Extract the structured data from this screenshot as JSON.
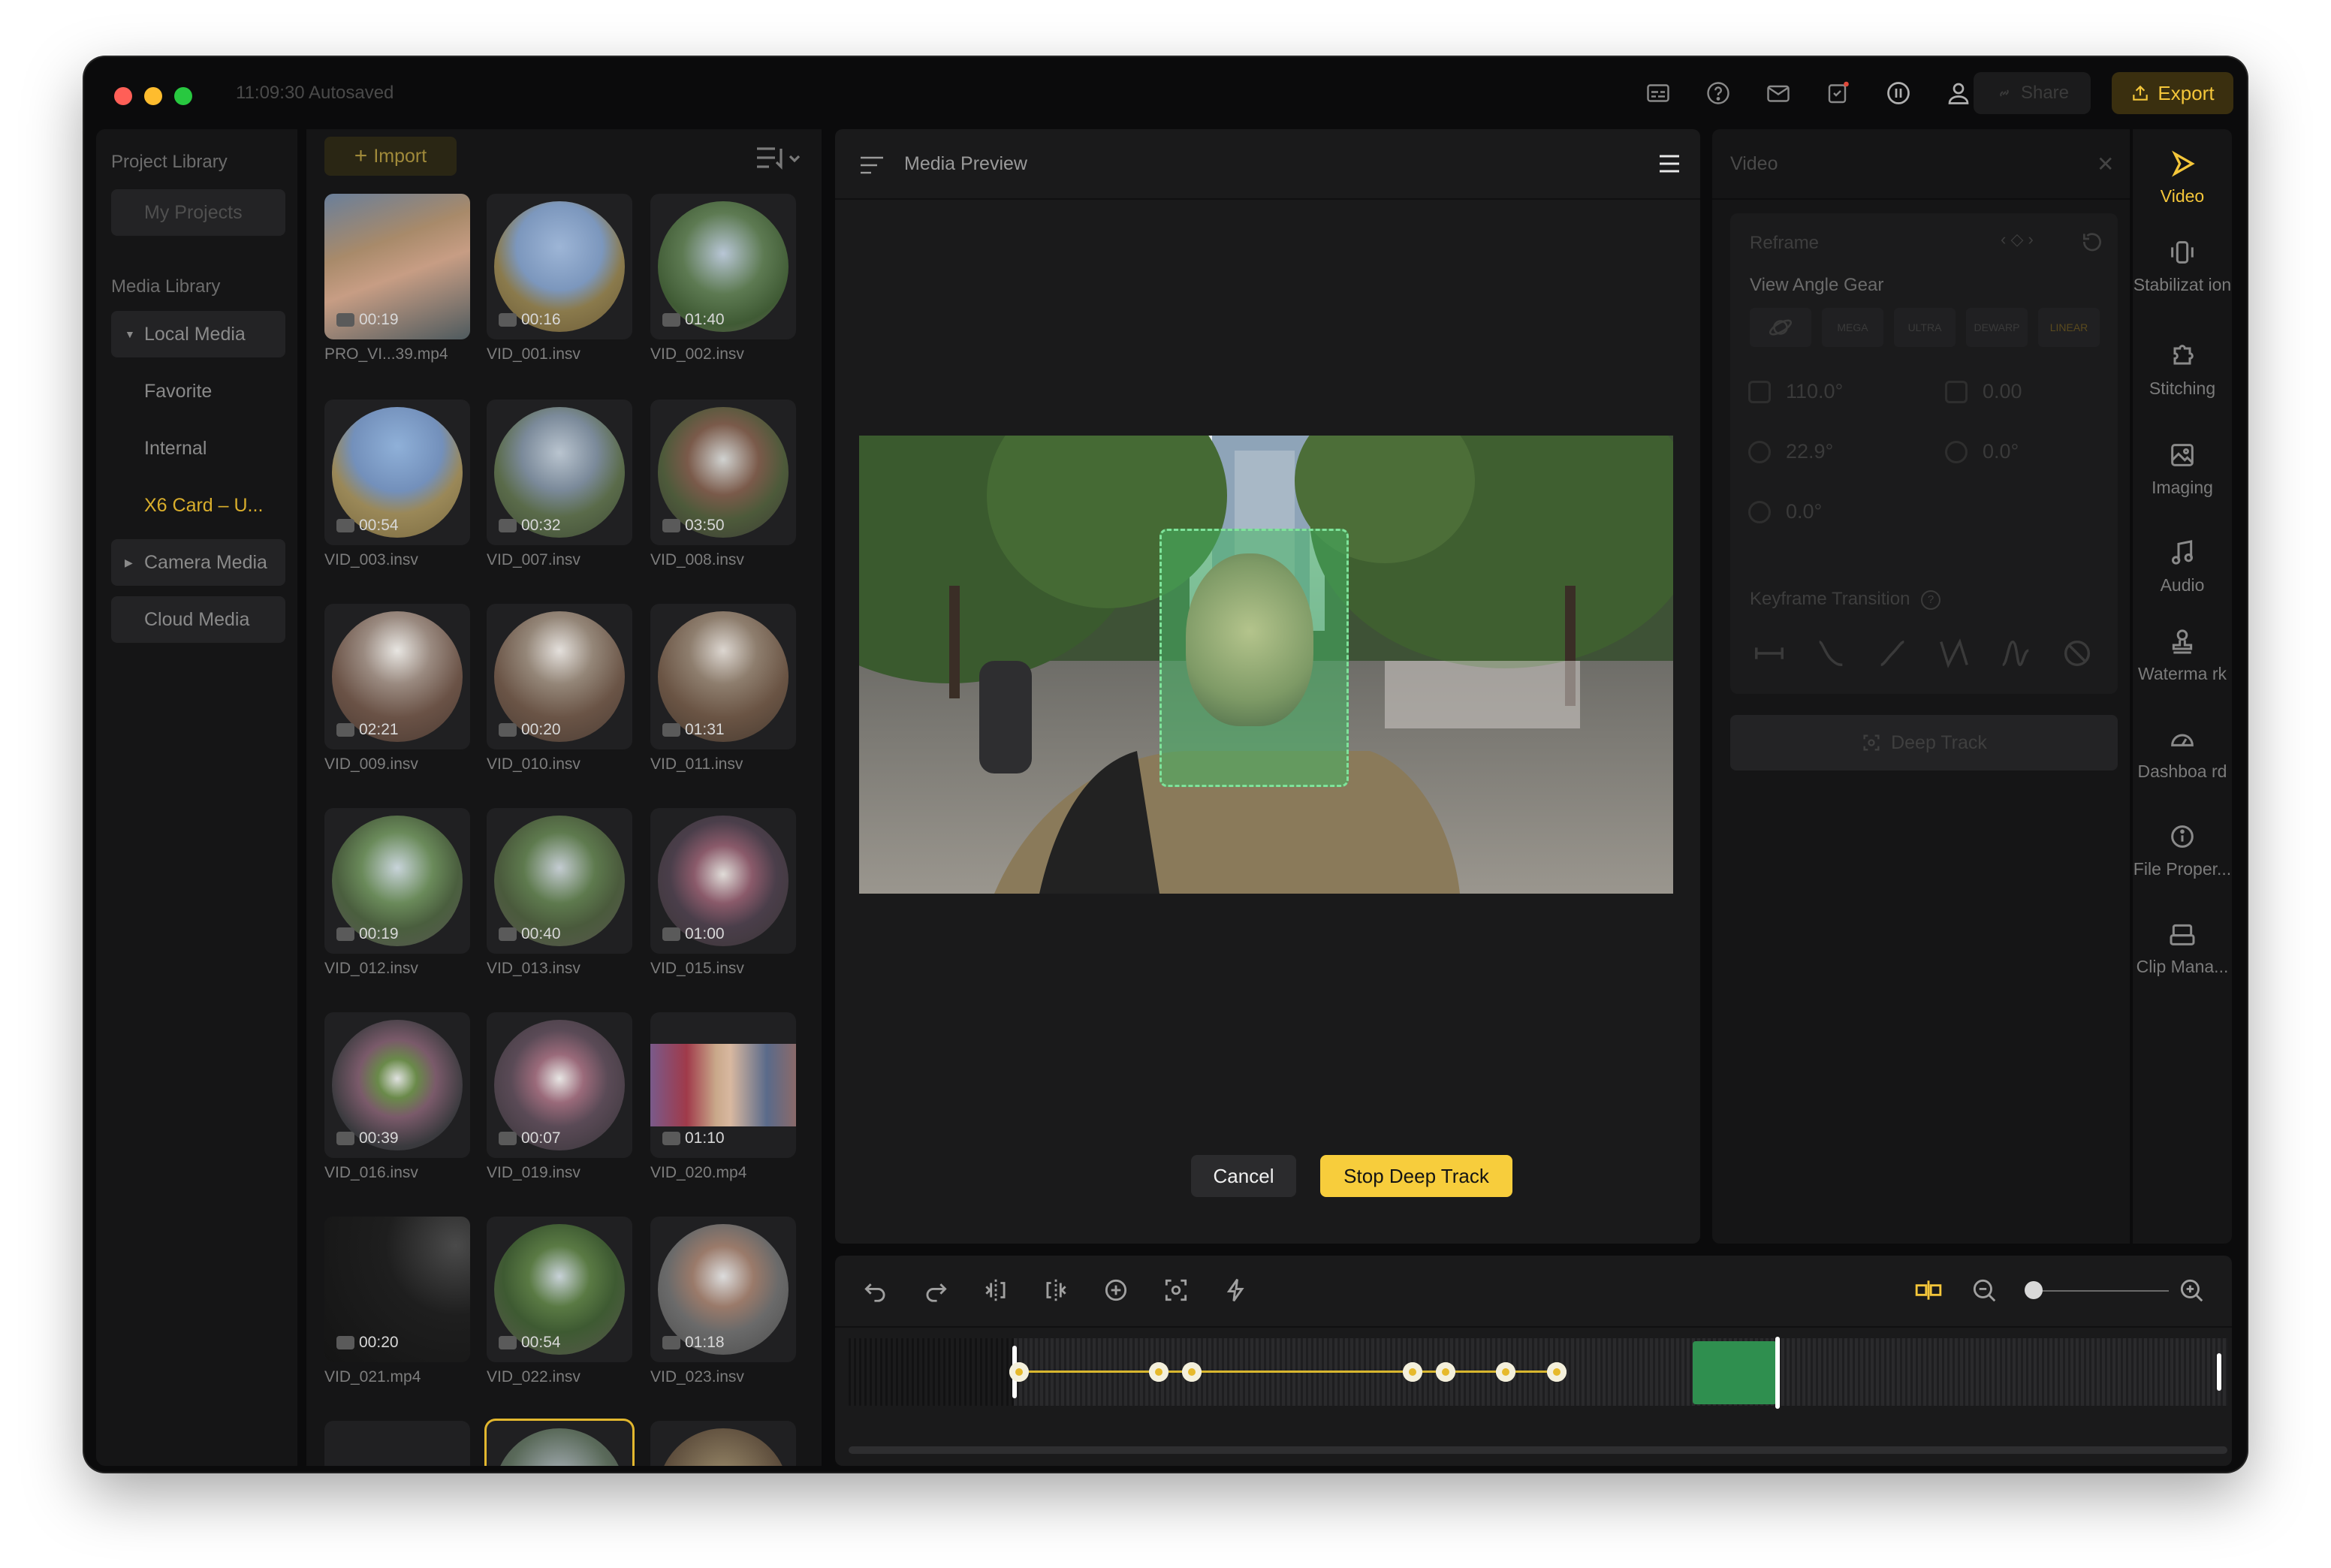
{
  "window": {
    "autosave": "11:09:30 Autosaved",
    "share_label": "Share",
    "export_label": "Export",
    "traffic_colors": [
      "#ff5f57",
      "#febc2e",
      "#28c840"
    ]
  },
  "library": {
    "project_header": "Project Library",
    "my_projects": "My Projects",
    "media_header": "Media Library",
    "items": [
      {
        "label": "Local Media"
      },
      {
        "label": "Favorite"
      },
      {
        "label": "Internal"
      },
      {
        "label": "X6 Card – U..."
      },
      {
        "label": "Camera Media"
      },
      {
        "label": "Cloud Media"
      }
    ]
  },
  "grid": {
    "import_label": "Import",
    "clips": [
      {
        "name": "PRO_VI...39.mp4",
        "duration": "00:19"
      },
      {
        "name": "VID_001.insv",
        "duration": "00:16"
      },
      {
        "name": "VID_002.insv",
        "duration": "01:40"
      },
      {
        "name": "VID_003.insv",
        "duration": "00:54"
      },
      {
        "name": "VID_007.insv",
        "duration": "00:32"
      },
      {
        "name": "VID_008.insv",
        "duration": "03:50"
      },
      {
        "name": "VID_009.insv",
        "duration": "02:21"
      },
      {
        "name": "VID_010.insv",
        "duration": "00:20"
      },
      {
        "name": "VID_011.insv",
        "duration": "01:31"
      },
      {
        "name": "VID_012.insv",
        "duration": "00:19"
      },
      {
        "name": "VID_013.insv",
        "duration": "00:40"
      },
      {
        "name": "VID_015.insv",
        "duration": "01:00"
      },
      {
        "name": "VID_016.insv",
        "duration": "00:39"
      },
      {
        "name": "VID_019.insv",
        "duration": "00:07"
      },
      {
        "name": "VID_020.mp4",
        "duration": "01:10"
      },
      {
        "name": "VID_021.mp4",
        "duration": "00:20"
      },
      {
        "name": "VID_022.insv",
        "duration": "00:54"
      },
      {
        "name": "VID_023.insv",
        "duration": "01:18"
      }
    ]
  },
  "preview": {
    "title": "Media Preview",
    "cancel_label": "Cancel",
    "stop_label": "Stop Deep Track"
  },
  "video_panel": {
    "title": "Video",
    "reframe": "Reframe",
    "view_angle_gear": "View Angle Gear",
    "gears": [
      "",
      "MEGA",
      "ULTRA",
      "DEWARP",
      "LINEAR"
    ],
    "fov": "110.0°",
    "distance": "0.00",
    "yaw": "22.9°",
    "pitch": "0.0°",
    "roll": "0.0°",
    "keyframe_transition": "Keyframe Transition",
    "deep_track": "Deep Track"
  },
  "rail": [
    {
      "label": "Video"
    },
    {
      "label": "Stabilizat ion"
    },
    {
      "label": "Stitching"
    },
    {
      "label": "Imaging"
    },
    {
      "label": "Audio"
    },
    {
      "label": "Waterma rk"
    },
    {
      "label": "Dashboa rd"
    },
    {
      "label": "File Proper..."
    },
    {
      "label": "Clip Mana..."
    }
  ],
  "timeline": {
    "zoom_level": 0.0,
    "accent": "#f4c63a",
    "track_highlight": "#2f8f4f"
  }
}
